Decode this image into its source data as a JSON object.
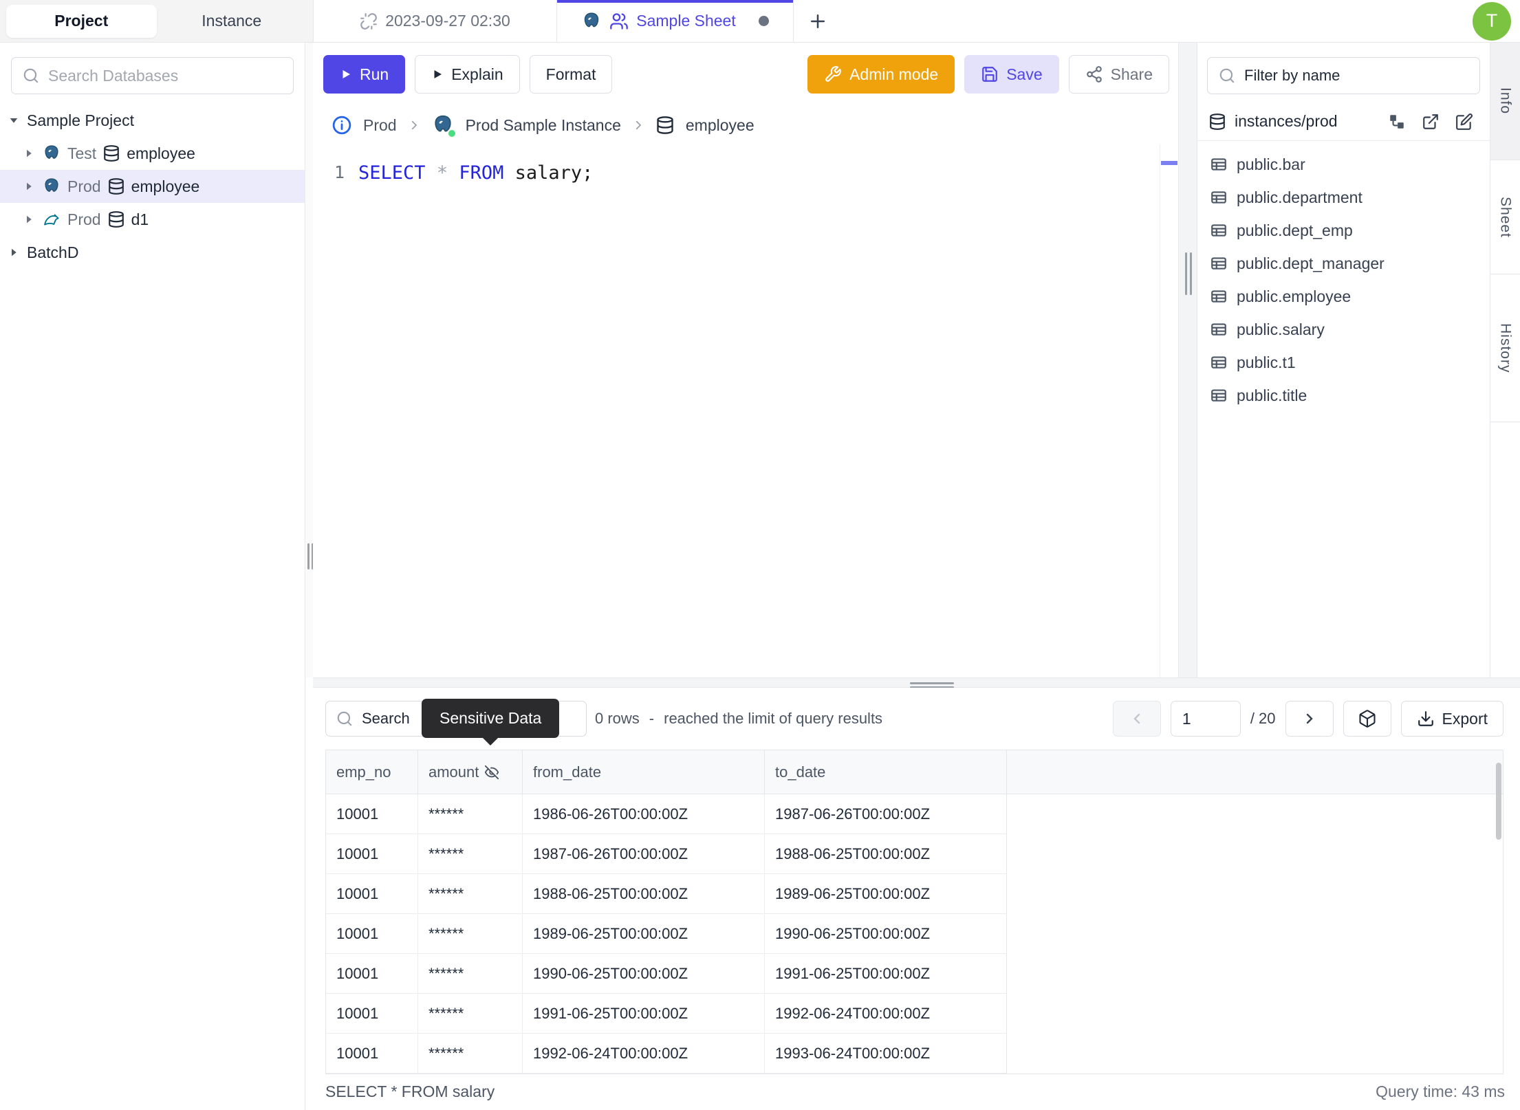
{
  "topbar": {
    "left_switch": {
      "project": "Project",
      "instance": "Instance"
    },
    "tabs": [
      {
        "label": "2023-09-27 02:30"
      },
      {
        "label": "Sample Sheet"
      }
    ],
    "new_tab_label": "+",
    "avatar_initial": "T"
  },
  "sidebar_left": {
    "search_placeholder": "Search Databases",
    "tree": {
      "project_label": "Sample Project",
      "items": [
        {
          "env": "Test",
          "db": "employee",
          "engine": "postgresql"
        },
        {
          "env": "Prod",
          "db": "employee",
          "engine": "postgresql",
          "selected": true
        },
        {
          "env": "Prod",
          "db": "d1",
          "engine": "mysql"
        },
        {
          "label": "BatchD"
        }
      ]
    }
  },
  "toolbar": {
    "run_label": "Run",
    "explain_label": "Explain",
    "format_label": "Format",
    "admin_mode_label": "Admin mode",
    "save_label": "Save",
    "share_label": "Share"
  },
  "breadcrumb": {
    "env": "Prod",
    "instance": "Prod Sample Instance",
    "database": "employee"
  },
  "editor": {
    "line_number": "1",
    "tokens": [
      {
        "t": "SELECT",
        "c": "kw"
      },
      {
        "t": "*",
        "c": "op"
      },
      {
        "t": "FROM",
        "c": "kw"
      },
      {
        "t": "salary;",
        "c": "id"
      }
    ]
  },
  "sidebar_right": {
    "filter_placeholder": "Filter by name",
    "database_label": "instances/prod",
    "tables": [
      "public.bar",
      "public.department",
      "public.dept_emp",
      "public.dept_manager",
      "public.employee",
      "public.salary",
      "public.t1",
      "public.title"
    ]
  },
  "right_tabs": [
    "Info",
    "Sheet",
    "History"
  ],
  "results": {
    "search_placeholder": "Search",
    "tooltip_text": "Sensitive Data",
    "rows_count": "0 rows",
    "rows_separator": "-",
    "limit_message": "reached the limit of query results",
    "pagination": {
      "page": "1",
      "total": "/ 20"
    },
    "export_label": "Export",
    "columns": [
      "emp_no",
      "amount",
      "from_date",
      "to_date"
    ],
    "rows": [
      [
        "10001",
        "******",
        "1986-06-26T00:00:00Z",
        "1987-06-26T00:00:00Z"
      ],
      [
        "10001",
        "******",
        "1987-06-26T00:00:00Z",
        "1988-06-25T00:00:00Z"
      ],
      [
        "10001",
        "******",
        "1988-06-25T00:00:00Z",
        "1989-06-25T00:00:00Z"
      ],
      [
        "10001",
        "******",
        "1989-06-25T00:00:00Z",
        "1990-06-25T00:00:00Z"
      ],
      [
        "10001",
        "******",
        "1990-06-25T00:00:00Z",
        "1991-06-25T00:00:00Z"
      ],
      [
        "10001",
        "******",
        "1991-06-25T00:00:00Z",
        "1992-06-24T00:00:00Z"
      ],
      [
        "10001",
        "******",
        "1992-06-24T00:00:00Z",
        "1993-06-24T00:00:00Z"
      ]
    ],
    "status_left": "SELECT * FROM salary",
    "status_right": "Query time: 43 ms"
  },
  "icons": {
    "tab1": "unlink-icon",
    "tab2_db": "postgresql-icon",
    "tab2_shared": "users-icon",
    "run": "play-icon",
    "admin": "wrench-icon",
    "save": "floppy-icon",
    "share": "share-icon",
    "breadcrumb_info": "info-icon",
    "database": "database-cylinder-icon",
    "table": "table-icon",
    "schema": "schema-diagram-icon",
    "open": "external-link-icon",
    "edit": "edit-icon",
    "masked_column": "eye-off-icon",
    "export": "download-icon",
    "result_extra": "box-icon",
    "search": "search-icon"
  },
  "colors": {
    "accent": "#4f46e5",
    "accent_soft": "#e4e1fb",
    "admin_orange": "#f0a20c",
    "selected_row": "#ecebfb",
    "avatar_green": "#7cc342",
    "status_green": "#4ade80",
    "keyword_blue": "#2424dd",
    "tooltip_bg": "#2b2b2e",
    "postgres_blue": "#336791",
    "mysql_teal": "#00758f"
  }
}
